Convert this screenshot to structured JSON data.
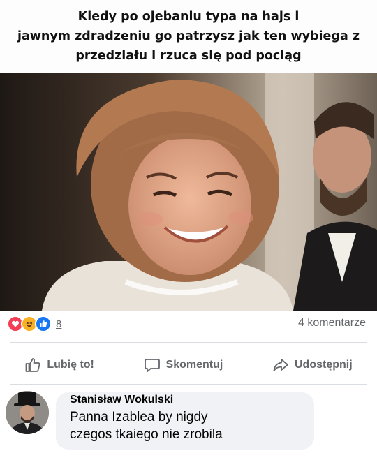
{
  "meme_caption": "Kiedy po ojebaniu typa na hajs i\njawnym zdradzeniu go patrzysz jak ten wybiega z\nprzedziału i rzuca się pod pociąg",
  "post": {
    "reaction_icons": [
      "love-icon",
      "haha-icon",
      "like-icon"
    ],
    "reaction_count": "8",
    "comments_count_label": "4 komentarze"
  },
  "actions": {
    "like_label": "Lubię to!",
    "comment_label": "Skomentuj",
    "share_label": "Udostępnij"
  },
  "comment": {
    "author": "Stanisław Wokulski",
    "text": "Panna Izablea by nigdy\nczegos tkaiego nie zrobila"
  },
  "colors": {
    "love": "#f33e58",
    "haha": "#f7b125",
    "like": "#1877f2",
    "muted_text": "#65676b",
    "bubble": "#f0f2f5"
  }
}
